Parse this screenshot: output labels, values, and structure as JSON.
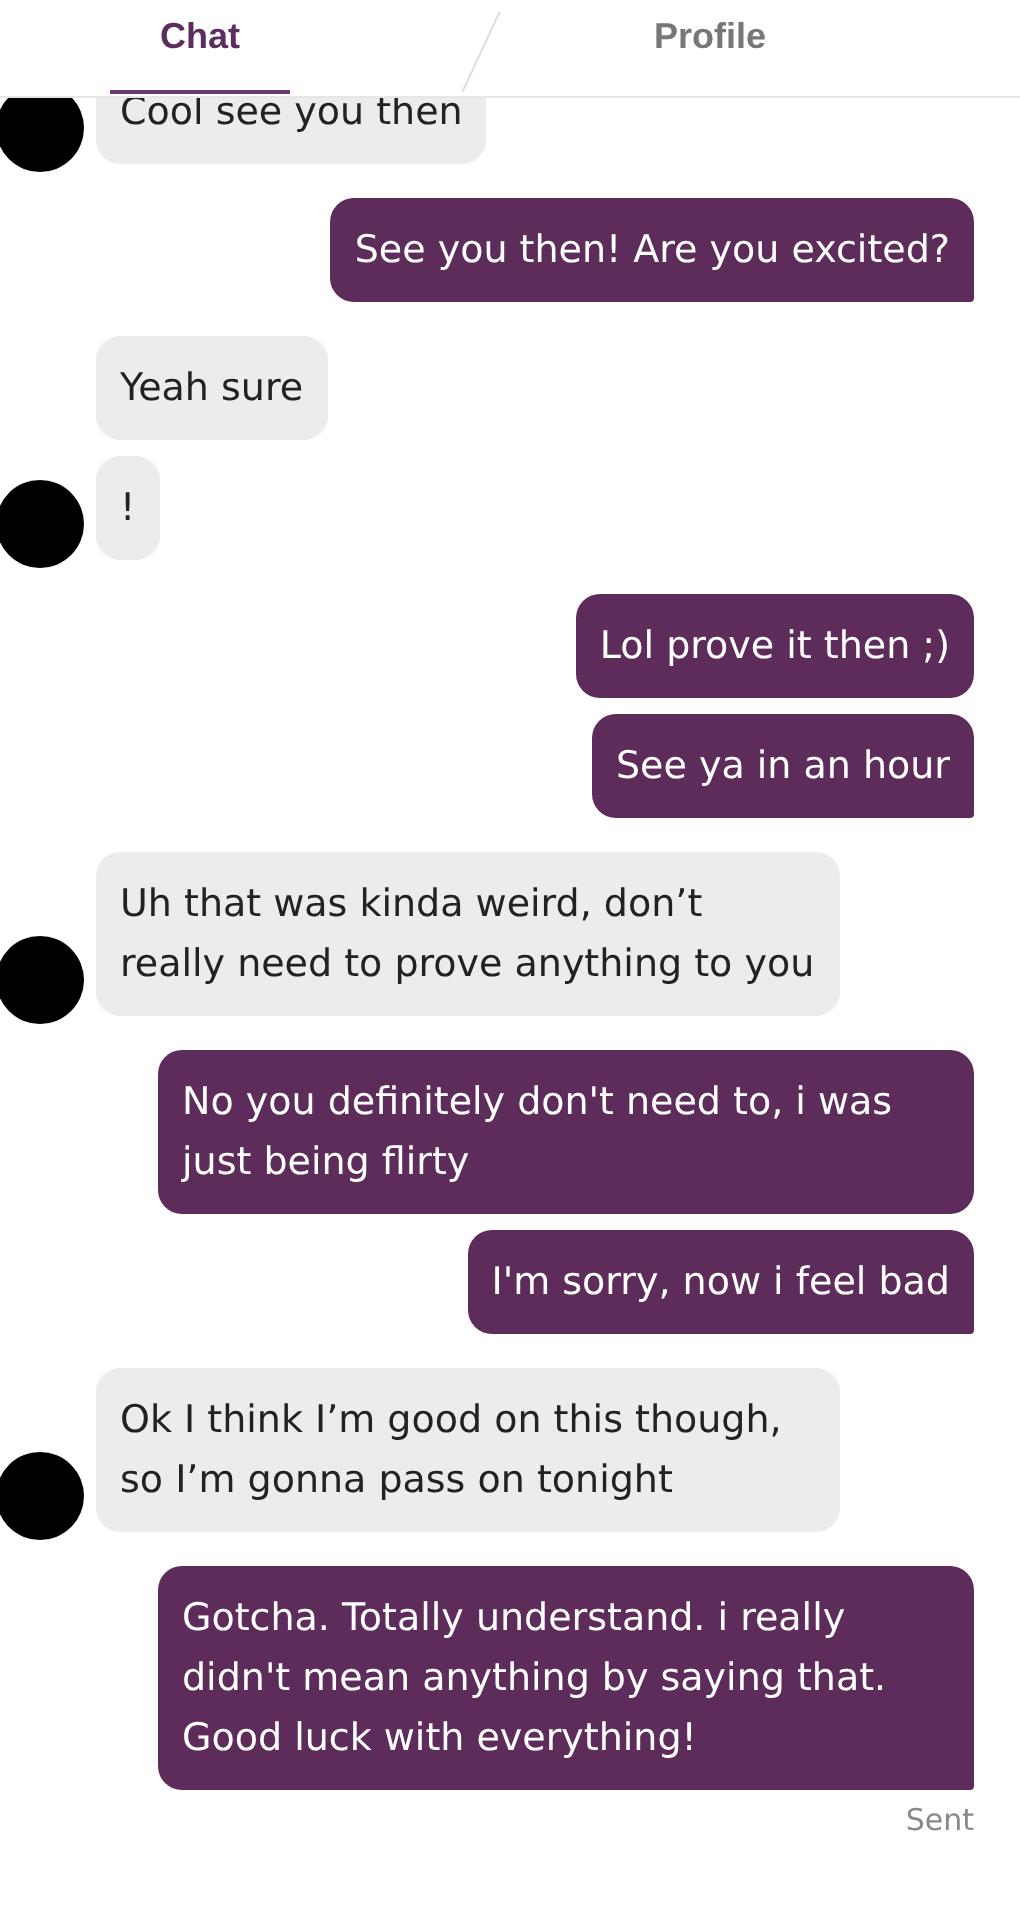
{
  "tabs": [
    {
      "label": "Chat",
      "selected": true
    },
    {
      "label": "Profile",
      "selected": false
    }
  ],
  "messages": [
    {
      "kind": "received",
      "text": "Cool see you then",
      "avatar": true
    },
    {
      "kind": "sent",
      "text": "See you then! Are you excited?",
      "tail": true
    },
    {
      "kind": "received",
      "text": "Yeah sure",
      "avatar": false
    },
    {
      "kind": "received",
      "text": "!",
      "avatar": true
    },
    {
      "kind": "sent",
      "text": "Lol prove it then ;)",
      "tail": false
    },
    {
      "kind": "sent",
      "text": "See ya in an hour",
      "tail": true
    },
    {
      "kind": "received",
      "text": "Uh that was kinda weird, don’t really need to prove anything to you",
      "avatar": true
    },
    {
      "kind": "sent",
      "text": "No you definitely don't need to, i was just being flirty",
      "tail": false
    },
    {
      "kind": "sent",
      "text": "I'm sorry, now i feel bad",
      "tail": true
    },
    {
      "kind": "received",
      "text": "Ok I think I’m good on this though, so I’m gonna pass on tonight",
      "avatar": true
    },
    {
      "kind": "sent",
      "text": "Gotcha. Totally understand. i really didn't mean anything by saying that. Good luck with everything!",
      "tail": true
    }
  ],
  "status": "Sent"
}
